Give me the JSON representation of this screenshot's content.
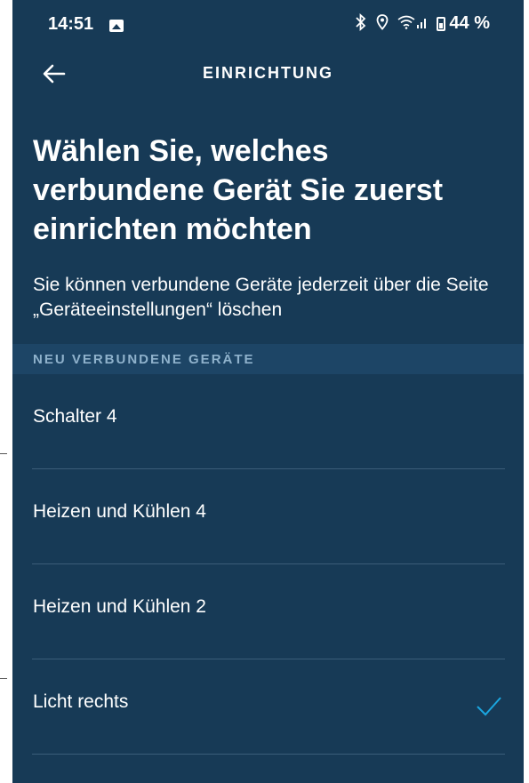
{
  "status_bar": {
    "time": "14:51",
    "battery_percent": "44 %",
    "icons": [
      "image-icon",
      "bluetooth-icon",
      "location-icon",
      "wifi-icon",
      "signal-icon",
      "battery-icon"
    ]
  },
  "app_bar": {
    "back_icon": "arrow-left-icon",
    "title": "EINRICHTUNG"
  },
  "main": {
    "headline": "Wählen Sie, welches verbundene Gerät Sie zuerst einrichten möchten",
    "subtext": "Sie können verbundene Geräte jederzeit über die Seite „Geräteeinstellungen“ löschen",
    "section_title": "NEU VERBUNDENE GERÄTE",
    "devices": [
      {
        "label": "Schalter 4",
        "selected": false
      },
      {
        "label": "Heizen und Kühlen 4",
        "selected": false
      },
      {
        "label": "Heizen und Kühlen 2",
        "selected": false
      },
      {
        "label": "Licht rechts",
        "selected": true
      }
    ]
  },
  "colors": {
    "background": "#173a56",
    "section_header": "#1d4566",
    "section_text": "#8fb2cc",
    "divider": "#3b5d79",
    "check": "#1aa6e0"
  }
}
